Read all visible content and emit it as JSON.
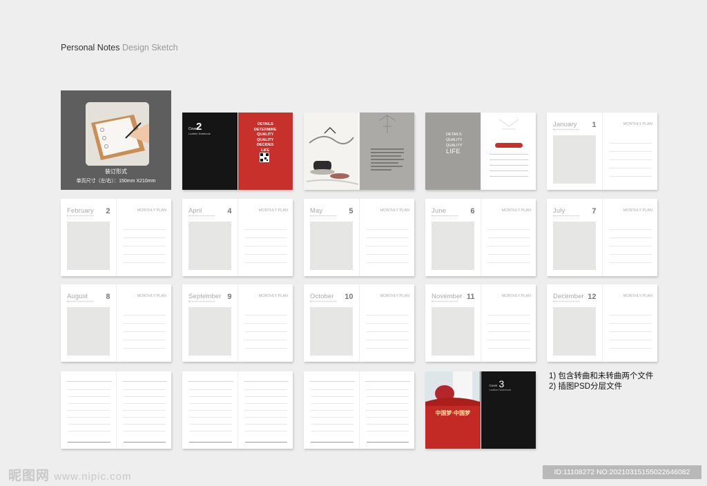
{
  "header": {
    "title_bold": "Personal Notes",
    "title_light": "Design Sketch"
  },
  "binding": {
    "caption_line1": "装订形式",
    "caption_line2": "单页尺寸（左/右）：150mm X210mm"
  },
  "cover2": {
    "number": "2",
    "cover_label": "Cover",
    "subtitle": "Leather Notebook",
    "slogan": [
      "DETAILS",
      "DETERMINE",
      "QUALITY",
      "QUALITY",
      "DECIDES",
      "LIFE"
    ]
  },
  "cover3": {
    "number": "3",
    "cover_label": "Cover",
    "subtitle": "Leather Notebook",
    "headline_cn": "中国梦·中国梦"
  },
  "details_spread": {
    "lines": [
      "DETAILS",
      "QUALITY",
      "QUALITY",
      "LIFE"
    ]
  },
  "monthly_plan_label": "MONTHLY PLAN",
  "months": [
    {
      "name": "January",
      "number": "1"
    },
    {
      "name": "February",
      "number": "2"
    },
    {
      "name": "April",
      "number": "4"
    },
    {
      "name": "May",
      "number": "5"
    },
    {
      "name": "June",
      "number": "6"
    },
    {
      "name": "July",
      "number": "7"
    },
    {
      "name": "August",
      "number": "8"
    },
    {
      "name": "September",
      "number": "9"
    },
    {
      "name": "October",
      "number": "10"
    },
    {
      "name": "November",
      "number": "11"
    },
    {
      "name": "December",
      "number": "12"
    }
  ],
  "notes": [
    "1) 包含转曲和未转曲两个文件",
    "2) 插图PSD分层文件"
  ],
  "watermark": {
    "brand": "昵图网",
    "url": "www.nipic.com"
  },
  "id_bar": "ID:11108272 NO:20210315155022646082",
  "colors": {
    "cover_red": "#c7302b",
    "cover_black": "#151515",
    "binding_grey": "#5e5e5e",
    "details_grey": "#a09e9b"
  }
}
